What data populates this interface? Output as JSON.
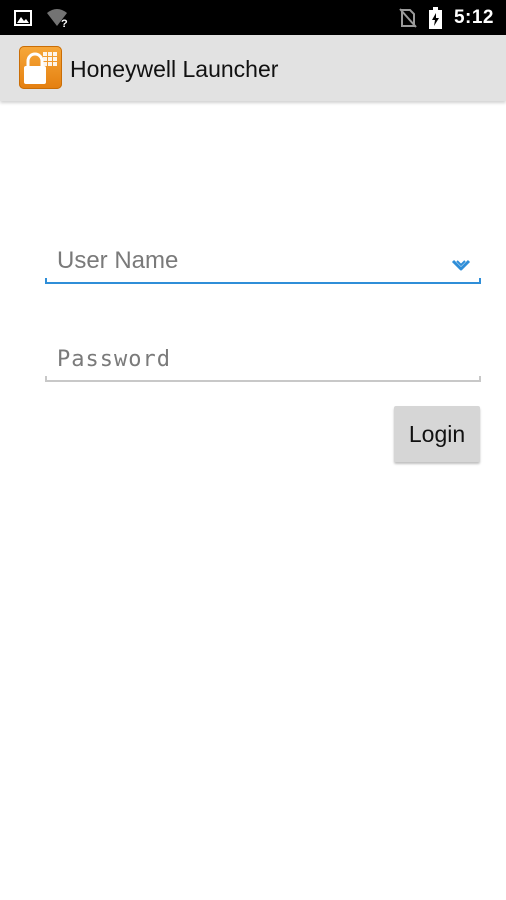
{
  "status_bar": {
    "time": "5:12",
    "icons": [
      "image-notification-icon",
      "wifi-unknown-icon",
      "no-sim-icon",
      "battery-charging-icon"
    ]
  },
  "app_bar": {
    "title": "Honeywell Launcher",
    "icon": "lock-keypad-app-icon"
  },
  "login_form": {
    "username_placeholder": "User Name",
    "username_value": "",
    "password_placeholder": "Password",
    "password_value": "",
    "login_label": "Login"
  },
  "colors": {
    "status_bar": "#000000",
    "app_bar": "#e2e2e2",
    "app_icon": "#f29624",
    "focus_accent": "#2f8ed8",
    "button": "#d6d6d6"
  }
}
